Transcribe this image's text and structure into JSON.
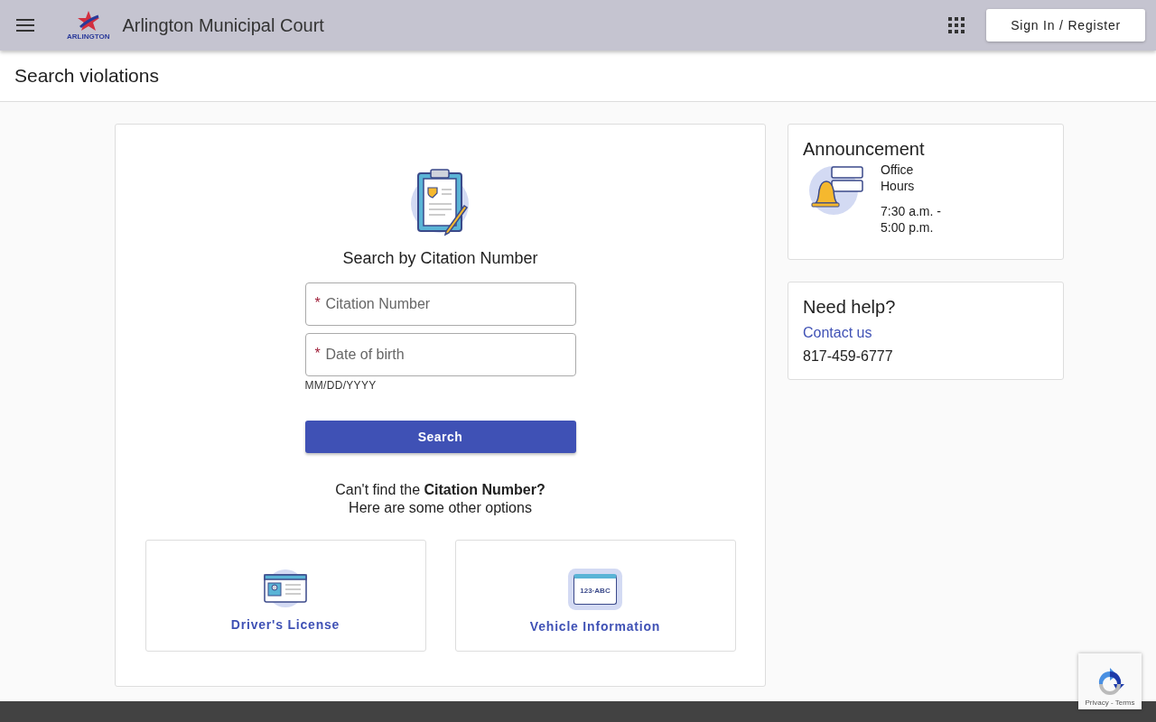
{
  "header": {
    "logo_text": "ARLINGTON",
    "title": "Arlington Municipal Court",
    "sign_in": "Sign In / Register"
  },
  "page_title": "Search violations",
  "search": {
    "heading": "Search by Citation Number",
    "fields": [
      {
        "placeholder": "Citation Number",
        "required_mark": "*"
      },
      {
        "placeholder": "Date of birth",
        "required_mark": "*",
        "hint": "MM/DD/YYYY"
      }
    ],
    "button": "Search",
    "help_text": "Can't find the **Citation Number?**",
    "help_text_2": "Here are some other options",
    "options": [
      {
        "kind": "license",
        "label": "Driver's License"
      },
      {
        "kind": "vehicle",
        "label": "Vehicle Information",
        "plate_text": "123·ABC"
      }
    ]
  },
  "announcement": {
    "title": "Announcement",
    "lines": [
      "Office Hours",
      "7:30 a.m. - 5:00 p.m."
    ]
  },
  "help": {
    "title": "Need help?",
    "link": "Contact us",
    "phone": "817-459-6777"
  },
  "recaptcha": {
    "text": "Privacy - Terms"
  }
}
